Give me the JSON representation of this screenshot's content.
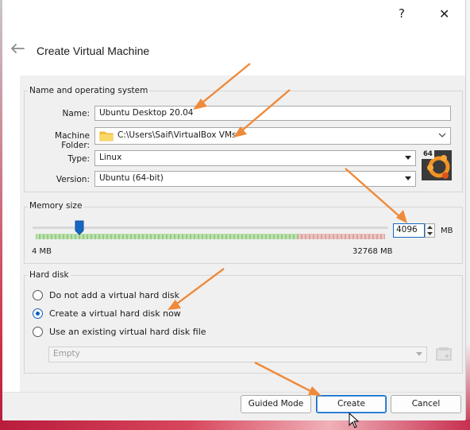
{
  "window": {
    "help_label": "?",
    "close_label": "✕"
  },
  "header": {
    "title": "Create Virtual Machine",
    "back_icon": "back-arrow-icon"
  },
  "name_os": {
    "group_title": "Name and operating system",
    "name_label": "Name:",
    "name_value": "Ubuntu Desktop 20.04",
    "folder_label": "Machine Folder:",
    "folder_value": "C:\\Users\\Saif\\VirtualBox VMs",
    "type_label": "Type:",
    "type_value": "Linux",
    "version_label": "Version:",
    "version_value": "Ubuntu (64-bit)",
    "os_badge": "64"
  },
  "memory": {
    "group_title": "Memory size",
    "value": "4096",
    "unit": "MB",
    "min_label": "4 MB",
    "max_label": "32768 MB",
    "slider_fraction": 0.125
  },
  "hard_disk": {
    "group_title": "Hard disk",
    "options": [
      {
        "label": "Do not add a virtual hard disk",
        "selected": false
      },
      {
        "label": "Create a virtual hard disk now",
        "selected": true
      },
      {
        "label": "Use an existing virtual hard disk file",
        "selected": false
      }
    ],
    "existing_value": "Empty"
  },
  "footer": {
    "guided_label": "Guided Mode",
    "create_label": "Create",
    "cancel_label": "Cancel"
  },
  "colors": {
    "accent": "#0f5fc0",
    "annotation_arrow": "#ef8a3a",
    "slider_green": "#b8e6a8",
    "slider_red": "#f2c2bc"
  }
}
